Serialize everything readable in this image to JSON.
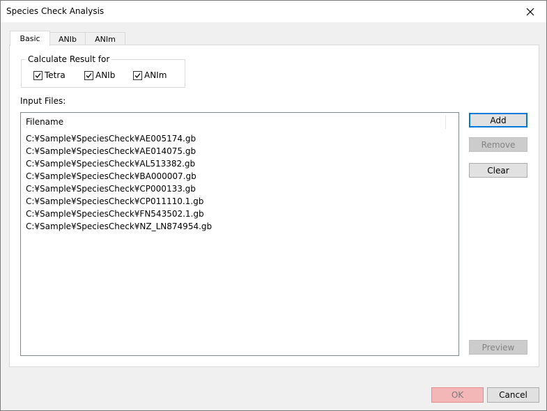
{
  "window": {
    "title": "Species Check Analysis"
  },
  "tabs": [
    {
      "label": "Basic"
    },
    {
      "label": "ANIb"
    },
    {
      "label": "ANIm"
    }
  ],
  "group": {
    "legend": "Calculate Result for",
    "options": [
      {
        "label": "Tetra",
        "checked": true
      },
      {
        "label": "ANIb",
        "checked": true
      },
      {
        "label": "ANIm",
        "checked": true
      }
    ]
  },
  "input_files": {
    "label": "Input Files:",
    "column_header": "Filename",
    "rows": [
      "C:¥Sample¥SpeciesCheck¥AE005174.gb",
      "C:¥Sample¥SpeciesCheck¥AE014075.gb",
      "C:¥Sample¥SpeciesCheck¥AL513382.gb",
      "C:¥Sample¥SpeciesCheck¥BA000007.gb",
      "C:¥Sample¥SpeciesCheck¥CP000133.gb",
      "C:¥Sample¥SpeciesCheck¥CP011110.1.gb",
      "C:¥Sample¥SpeciesCheck¥FN543502.1.gb",
      "C:¥Sample¥SpeciesCheck¥NZ_LN874954.gb"
    ]
  },
  "buttons": {
    "add": "Add",
    "remove": "Remove",
    "clear": "Clear",
    "preview": "Preview",
    "ok": "OK",
    "cancel": "Cancel"
  },
  "colors": {
    "accent": "#0078d7",
    "ok_bg": "#f4b7b7"
  }
}
